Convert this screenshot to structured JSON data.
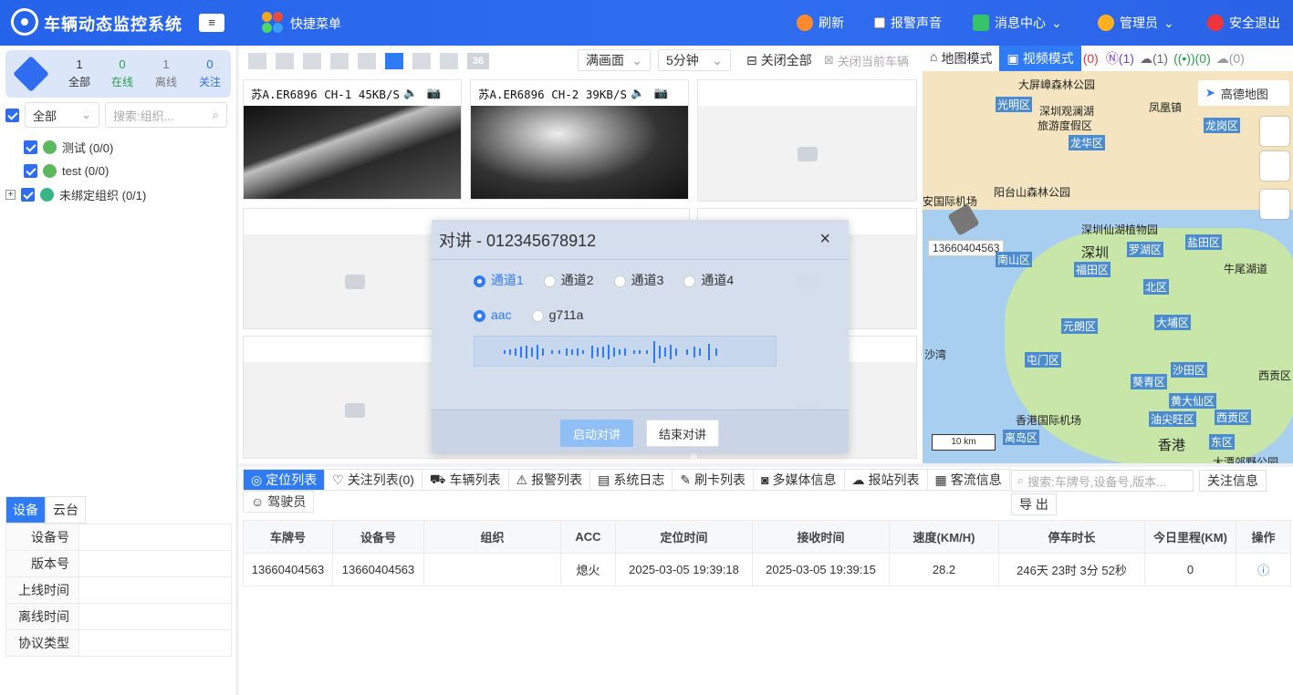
{
  "header": {
    "title": "车辆动态监控系统",
    "menu_btn": "≡",
    "quick_menu": "快捷菜单",
    "refresh": "刷新",
    "alarm_sound": "报警声音",
    "message_center": "消息中心",
    "admin": "管理员",
    "logout": "安全退出"
  },
  "sidebar": {
    "stats": [
      {
        "count": "1",
        "label": "全部"
      },
      {
        "count": "0",
        "label": "在线"
      },
      {
        "count": "1",
        "label": "离线"
      },
      {
        "count": "0",
        "label": "关注"
      }
    ],
    "filter_all": "全部",
    "search_placeholder": "搜索:组织...",
    "tree": [
      {
        "label": "测试 (0/0)"
      },
      {
        "label": "test (0/0)"
      },
      {
        "label": "未绑定组织 (0/1)"
      }
    ],
    "detail_tabs": [
      "设备",
      "云台"
    ],
    "detail_fields": [
      "设备号",
      "版本号",
      "上线时间",
      "离线时间",
      "协议类型"
    ]
  },
  "video": {
    "fill_mode": "满画面",
    "duration": "5分钟",
    "close_all": "关闭全部",
    "close_current": "关闭当前车辆",
    "layout_36": "36",
    "channels": [
      {
        "caption": "苏A.ER6896 CH-1 45KB/S"
      },
      {
        "caption": "苏A.ER6896 CH-2 39KB/S"
      }
    ]
  },
  "map": {
    "map_mode": "地图模式",
    "video_mode": "视频模式",
    "counts": [
      "(0)",
      "(1)",
      "(1)",
      "(0)",
      "(0)"
    ],
    "gaode": "高德地图",
    "vehicle_label": "13660404563",
    "scale": "10 km",
    "places": [
      "大屏嶂森林公园",
      "光明区",
      "深圳观澜湖",
      "旅游度假区",
      "凤凰镇",
      "龙岗区",
      "龙华区",
      "阳台山森林公园",
      "安国际机场",
      "深圳仙湖植物园",
      "深圳",
      "罗湖区",
      "盐田区",
      "南山区",
      "福田区",
      "牛尾湖道",
      "北区",
      "元朗区",
      "大埔区",
      "沙湾",
      "屯门区",
      "沙田区",
      "葵青区",
      "西贡区",
      "黄大仙区",
      "香港国际机场",
      "油尖旺区",
      "西贡区",
      "离岛区",
      "香港",
      "东区",
      "大潭郊野公园"
    ]
  },
  "bottom": {
    "tabs": [
      "定位列表",
      "关注列表(0)",
      "车辆列表",
      "报警列表",
      "系统日志",
      "刷卡列表",
      "多媒体信息",
      "报站列表",
      "客流信息",
      "驾驶员"
    ],
    "search_placeholder": "搜索:车牌号,设备号,版本...",
    "follow_info": "关注信息",
    "export": "导 出",
    "columns": [
      "车牌号",
      "设备号",
      "组织",
      "ACC",
      "定位时间",
      "接收时间",
      "速度(KM/H)",
      "停车时长",
      "今日里程(KM)",
      "操作"
    ],
    "rows": [
      [
        "13660404563",
        "13660404563",
        "",
        "熄火",
        "2025-03-05 19:39:18",
        "2025-03-05 19:39:15",
        "28.2",
        "246天 23时 3分 52秒",
        "0"
      ]
    ]
  },
  "intercom": {
    "title": "对讲 - 012345678912",
    "close": "×",
    "channels": [
      "通道1",
      "通道2",
      "通道3",
      "通道4"
    ],
    "codecs": [
      "aac",
      "g711a"
    ],
    "start": "启动对讲",
    "end": "结束对讲"
  }
}
